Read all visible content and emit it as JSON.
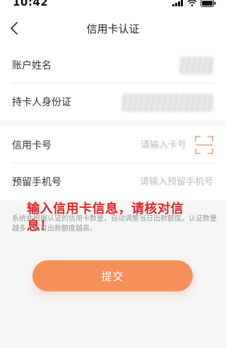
{
  "status": {
    "time": "10:42"
  },
  "nav": {
    "title": "信用卡认证"
  },
  "identity": {
    "name_label": "账户姓名",
    "id_label": "持卡人身份证"
  },
  "card_form": {
    "card_number_label": "信用卡号",
    "card_number_placeholder": "请输入卡号",
    "phone_label": "预留手机号",
    "phone_placeholder": "请输入预留手机号"
  },
  "notice_text": "系统会根据认证的信用卡数量，自动调整当日出款额度。认证数量越多，当日出款额度越高。",
  "overlay_text": "输入信用卡信息，请核对信息！",
  "submit_label": "提交",
  "colors": {
    "accent": "#f4915a",
    "overlay_red": "#e3242b",
    "scan_orange": "#f0a070"
  },
  "icons": [
    "back-chevron-icon",
    "scan-icon",
    "signal-icon",
    "wifi-icon",
    "battery-icon"
  ]
}
